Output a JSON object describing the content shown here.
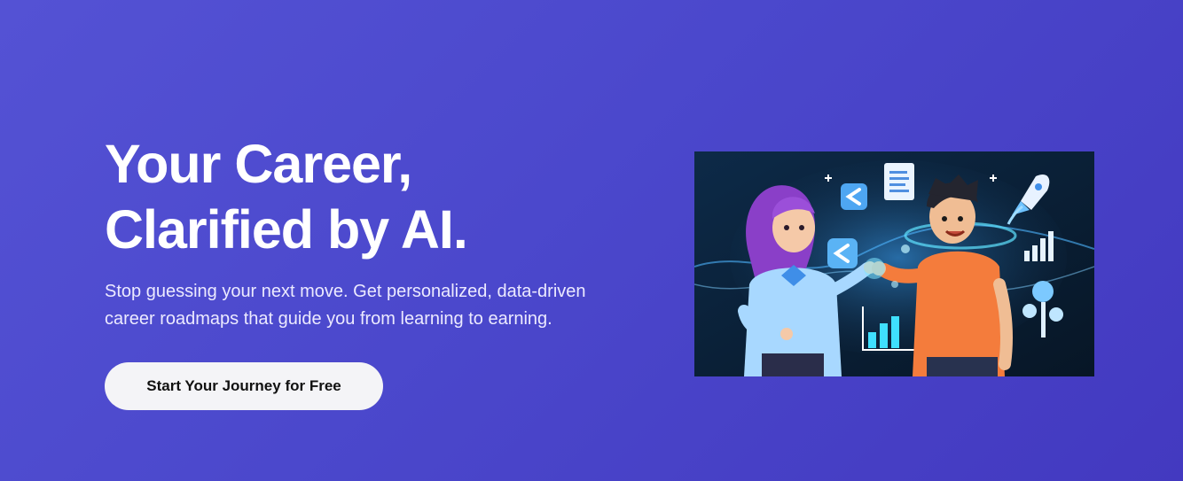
{
  "hero": {
    "title_line1": "Your Career,",
    "title_line2": "Clarified by AI.",
    "subtitle": "Stop guessing your next move. Get personalized, data-driven career roadmaps that guide you from learning to earning.",
    "cta_label": "Start Your Journey for Free"
  },
  "colors": {
    "background_start": "#5452d4",
    "background_end": "#4339c0",
    "cta_background": "#f4f4f7",
    "illustration_background": "#0b1e33"
  },
  "icons": [
    "code-bracket-icon",
    "document-icon",
    "rocket-icon",
    "bar-chart-icon",
    "growth-tree-icon",
    "sparkle-icon"
  ]
}
